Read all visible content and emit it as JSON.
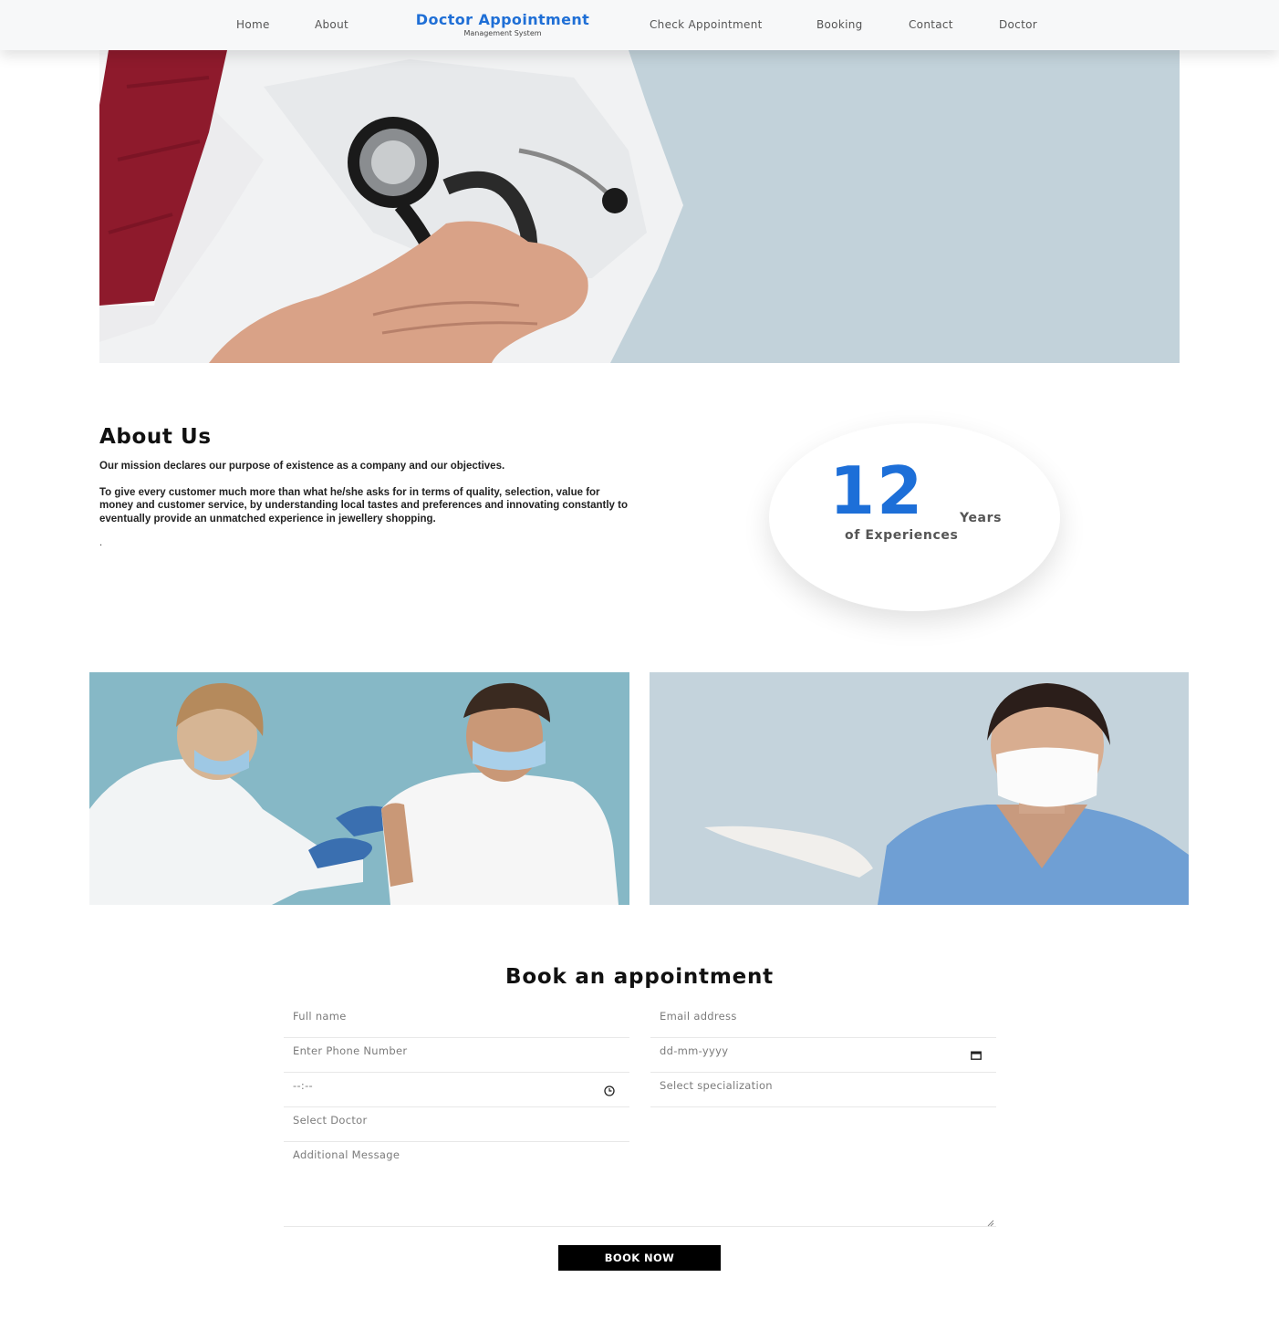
{
  "nav": {
    "links_left": [
      "Home",
      "About"
    ],
    "brand_title": "Doctor Appointment",
    "brand_subtitle": "Management System",
    "links_right": [
      "Check Appointment",
      "Booking",
      "Contact",
      "Doctor"
    ]
  },
  "about": {
    "title": "About Us",
    "mission": "Our mission declares our purpose of existence as a company and our objectives.",
    "body": "To give every customer much more than what he/she asks for in terms of quality, selection, value for money and customer service, by understanding local tastes and preferences and innovating constantly to eventually provide an unmatched experience in jewellery shopping.",
    "trailing": ".",
    "experience_number": "12",
    "experience_unit": "Years",
    "experience_label": "of Experiences"
  },
  "booking": {
    "title": "Book an appointment",
    "full_name_placeholder": "Full name",
    "email_placeholder": "Email address",
    "phone_placeholder": "Enter Phone Number",
    "date_placeholder": "dd-mm-yyyy",
    "time_placeholder": "--:--",
    "specialization_placeholder": "Select specialization",
    "doctor_placeholder": "Select Doctor",
    "message_placeholder": "Additional Message",
    "submit_label": "BOOK NOW"
  },
  "icons": {
    "calendar": "calendar-icon",
    "clock": "clock-icon",
    "resize": "resize-handle-icon"
  },
  "colors": {
    "brand": "#1f6fd6",
    "accent_number": "#1d6fd8",
    "button": "#000000",
    "hero_background": "#c2d2da"
  }
}
